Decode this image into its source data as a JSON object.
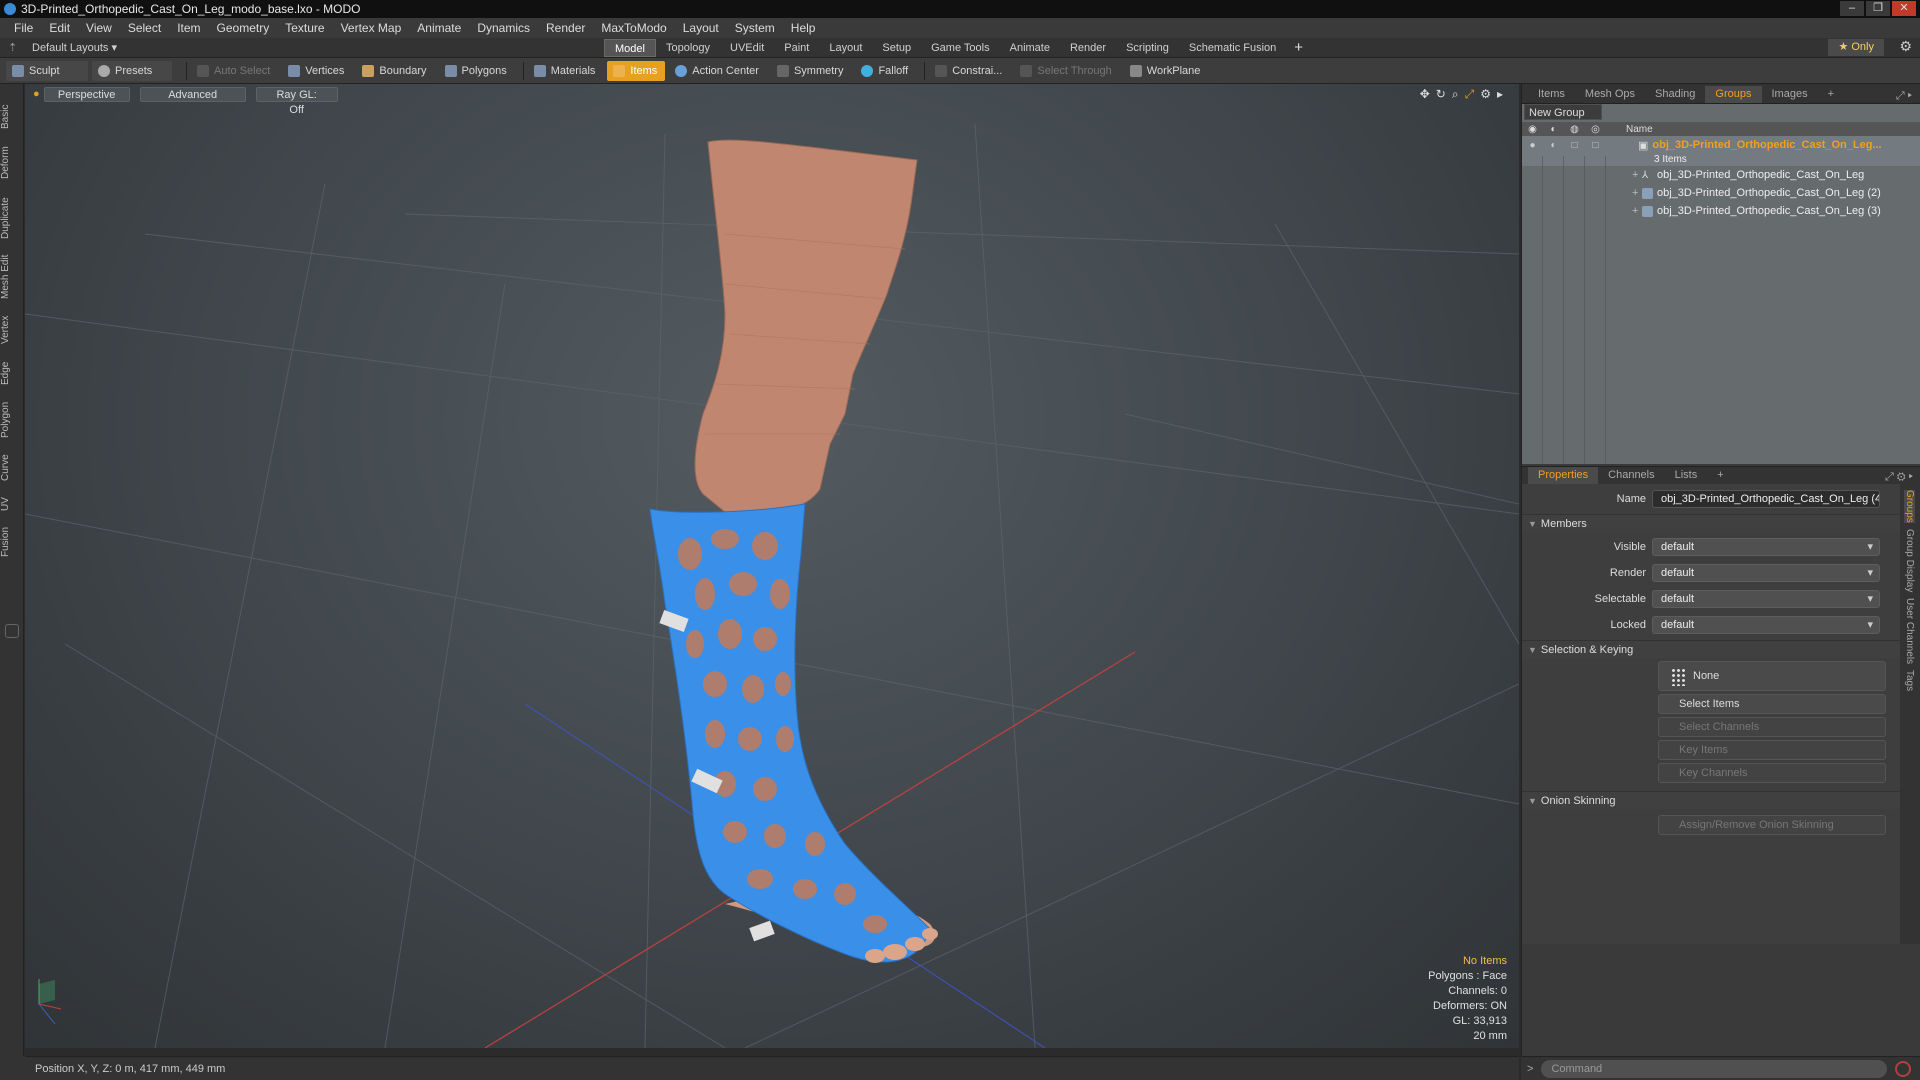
{
  "window": {
    "title": "3D-Printed_Orthopedic_Cast_On_Leg_modo_base.lxo - MODO",
    "buttons": [
      "–",
      "❐",
      "✕"
    ]
  },
  "menu": [
    "File",
    "Edit",
    "View",
    "Select",
    "Item",
    "Geometry",
    "Texture",
    "Vertex Map",
    "Animate",
    "Dynamics",
    "Render",
    "MaxToModo",
    "Layout",
    "System",
    "Help"
  ],
  "layoutbar": {
    "default_layouts": "Default Layouts ▾",
    "tabs": [
      "Model",
      "Topology",
      "UVEdit",
      "Paint",
      "Layout",
      "Setup",
      "Game Tools",
      "Animate",
      "Render",
      "Scripting",
      "Schematic Fusion"
    ],
    "active_tab": "Model",
    "plus": "+",
    "only": "★ Only",
    "gear": "⚙"
  },
  "toolbar": {
    "sculpt": "Sculpt",
    "presets": "Presets",
    "auto_select": "Auto Select",
    "vertices": "Vertices",
    "boundary": "Boundary",
    "polygons": "Polygons",
    "materials": "Materials",
    "items": "Items",
    "action_center": "Action Center",
    "symmetry": "Symmetry",
    "falloff": "Falloff",
    "constraints": "Constrai...",
    "select_through": "Select Through",
    "workplane": "WorkPlane"
  },
  "left_tabs": [
    "Basic",
    "Deform",
    "Duplicate",
    "Mesh Edit",
    "Vertex",
    "Edge",
    "Polygon",
    "Curve",
    "UV",
    "Fusion"
  ],
  "viewport": {
    "perspective": "Perspective",
    "advanced": "Advanced",
    "raygl": "Ray GL: Off",
    "info": {
      "selection": "No Items",
      "polygons": "Polygons : Face",
      "channels": "Channels: 0",
      "deformers": "Deformers: ON",
      "gl": "GL: 33,913",
      "scale": "20 mm"
    },
    "colors": {
      "skin": "#c98c70",
      "cast": "#3a8fe8",
      "strap": "#d8d8d8"
    }
  },
  "right_panel": {
    "tabs": [
      "Items",
      "Mesh Ops",
      "Shading",
      "Groups",
      "Images"
    ],
    "active_tab": "Groups",
    "new_group": "New Group",
    "name_header": "Name",
    "group": {
      "name": "obj_3D-Printed_Orthopedic_Cast_On_Leg...",
      "count": "3 Items",
      "children": [
        "obj_3D-Printed_Orthopedic_Cast_On_Leg",
        "obj_3D-Printed_Orthopedic_Cast_On_Leg (2)",
        "obj_3D-Printed_Orthopedic_Cast_On_Leg (3)"
      ]
    },
    "props_tabs": [
      "Properties",
      "Channels",
      "Lists"
    ],
    "props_active": "Properties",
    "props": {
      "name_label": "Name",
      "name_value": "obj_3D-Printed_Orthopedic_Cast_On_Leg (4",
      "members_section": "Members",
      "visible_label": "Visible",
      "visible_value": "default",
      "render_label": "Render",
      "render_value": "default",
      "selectable_label": "Selectable",
      "selectable_value": "default",
      "locked_label": "Locked",
      "locked_value": "default",
      "selection_section": "Selection & Keying",
      "none_btn": "None",
      "select_items": "Select Items",
      "select_channels": "Select Channels",
      "key_items": "Key Items",
      "key_channels": "Key Channels",
      "onion_section": "Onion Skinning",
      "onion_btn": "Assign/Remove Onion Skinning"
    },
    "side_tabs": [
      "Groups",
      "Group Display",
      "User Channels",
      "Tags"
    ]
  },
  "status": {
    "position": "Position X, Y, Z:  0 m, 417 mm, 449 mm",
    "command_placeholder": "Command",
    "prompt": ">"
  }
}
